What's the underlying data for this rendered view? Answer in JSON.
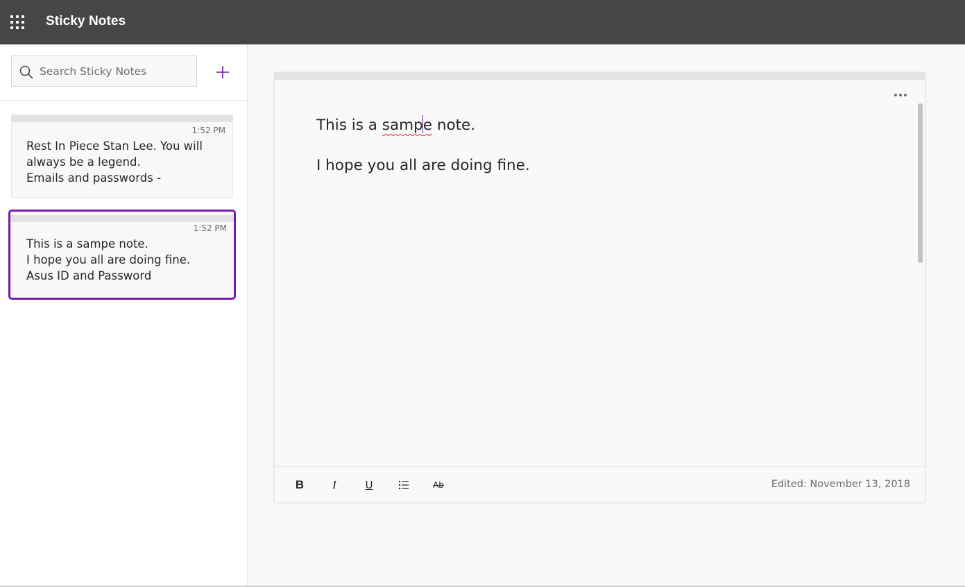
{
  "app": {
    "title": "Sticky Notes"
  },
  "search": {
    "placeholder": "Search Sticky Notes",
    "value": ""
  },
  "notes": [
    {
      "time": "1:52 PM",
      "lines": [
        "Rest In Piece Stan Lee. You will",
        "always be a legend.",
        "Emails and passwords -"
      ],
      "selected": false
    },
    {
      "time": "1:52 PM",
      "lines": [
        "This is a sampe note.",
        "I hope you all are doing fine.",
        "Asus ID and Password"
      ],
      "selected": true
    }
  ],
  "editor": {
    "line1_before": "This is a ",
    "line1_misspelled_a": "samp",
    "line1_misspelled_b": "e",
    "line1_after": " note.",
    "line2": "I hope you all are doing fine.",
    "toolbar": {
      "bold": "B",
      "italic": "I",
      "underline": "U",
      "strikethrough": "Ab"
    },
    "edited": "Edited: November 13, 2018"
  },
  "colors": {
    "topbar": "#484644",
    "accent": "#7719aa",
    "spelling_error": "#e0303a"
  },
  "icons": {
    "menu": "waffle-icon",
    "search": "search-icon",
    "add": "plus-icon",
    "more": "more-dots-icon",
    "list": "bulleted-list-icon"
  }
}
